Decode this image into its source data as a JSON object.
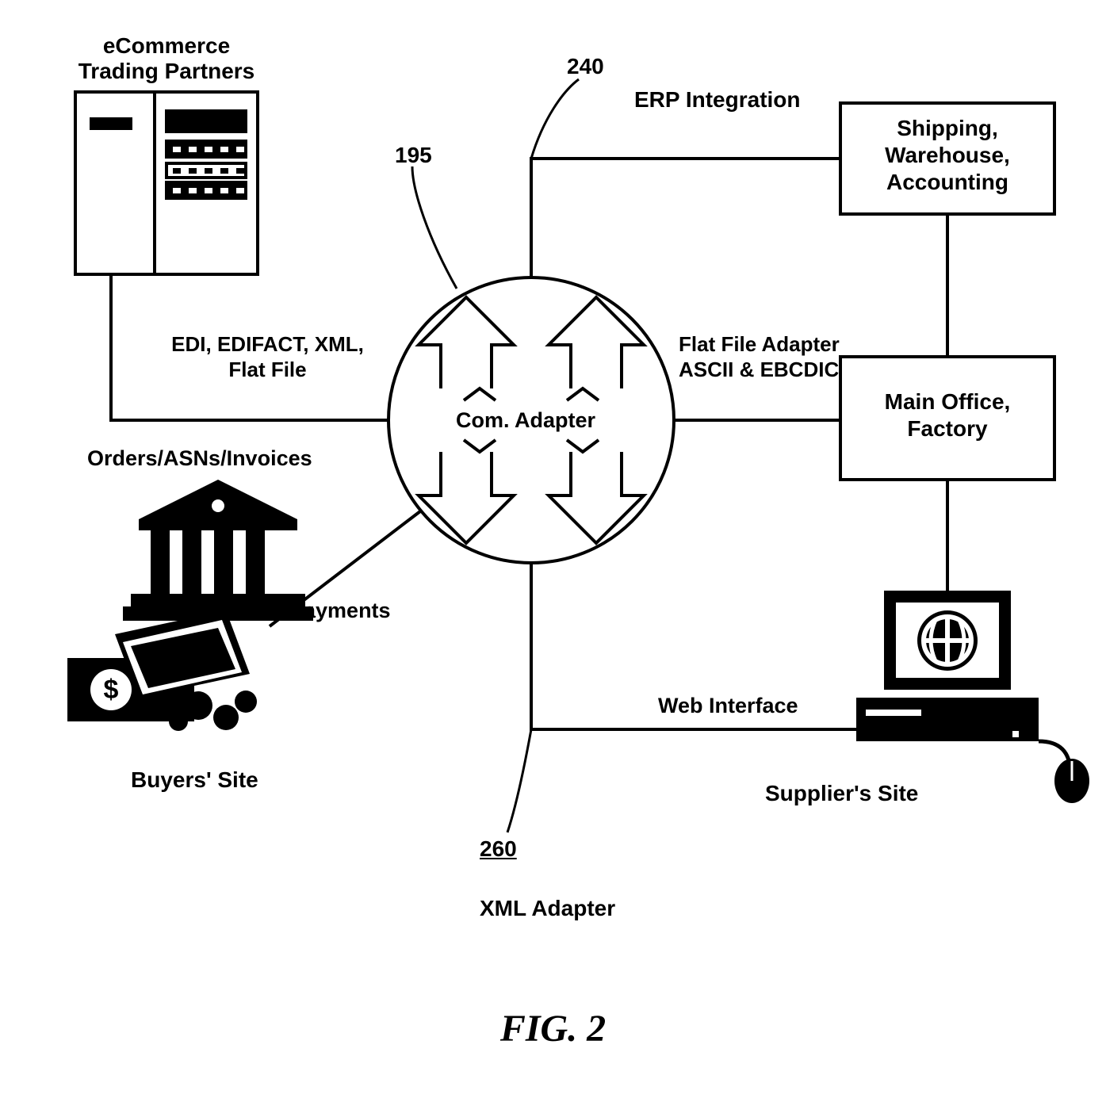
{
  "labels": {
    "ecommerce": "eCommerce\nTrading Partners",
    "ref240": "240",
    "erp": "ERP Integration",
    "shipping": "Shipping,\nWarehouse,\nAccounting",
    "ref195": "195",
    "edi": "EDI, EDIFACT, XML,\nFlat File",
    "flatfile": "Flat File Adapter\nASCII & EBCDIC",
    "mainoffice": "Main Office,\nFactory",
    "com": "Com. Adapter",
    "orders": "Orders/ASNs/Invoices",
    "payments": "Payments",
    "webinterface": "Web Interface",
    "buyers": "Buyers' Site",
    "suppliers": "Supplier's Site",
    "ref260": "260",
    "xmladapter": "XML Adapter",
    "figure": "FIG. 2"
  }
}
